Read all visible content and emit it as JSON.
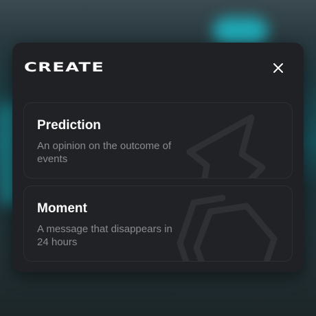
{
  "modal": {
    "title": "CREATE",
    "close_icon": "close-icon"
  },
  "options": [
    {
      "title": "Prediction",
      "description": "An opinion on the outcome of events",
      "icon": "lightning-icon"
    },
    {
      "title": "Moment",
      "description": "A message that disappears in 24 hours",
      "icon": "hexagon-icon"
    }
  ]
}
